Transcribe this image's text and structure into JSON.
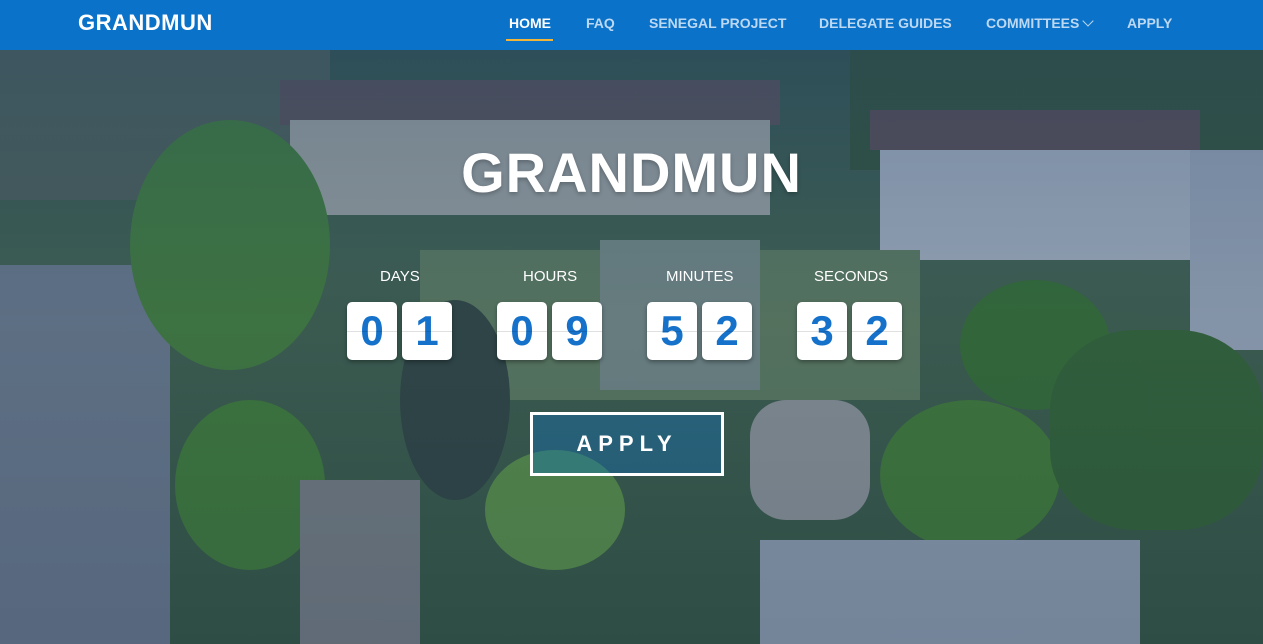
{
  "brand": "GRANDMUN",
  "nav": {
    "items": [
      {
        "label": "HOME",
        "active": true
      },
      {
        "label": "FAQ"
      },
      {
        "label": "SENEGAL PROJECT"
      },
      {
        "label": "DELEGATE GUIDES"
      },
      {
        "label": "COMMITTEES",
        "dropdown": true
      },
      {
        "label": "APPLY"
      }
    ]
  },
  "hero": {
    "title": "GRANDMUN",
    "countdown": {
      "days": {
        "label": "DAYS",
        "digits": [
          "0",
          "1"
        ]
      },
      "hours": {
        "label": "HOURS",
        "digits": [
          "0",
          "9"
        ]
      },
      "minutes": {
        "label": "MINUTES",
        "digits": [
          "5",
          "2"
        ]
      },
      "seconds": {
        "label": "SECONDS",
        "digits": [
          "3",
          "2"
        ]
      }
    },
    "apply_label": "APPLY"
  },
  "colors": {
    "navbar": "#0b72c9",
    "nav_active_underline": "#f2b53a",
    "digit_text": "#1571c9"
  }
}
